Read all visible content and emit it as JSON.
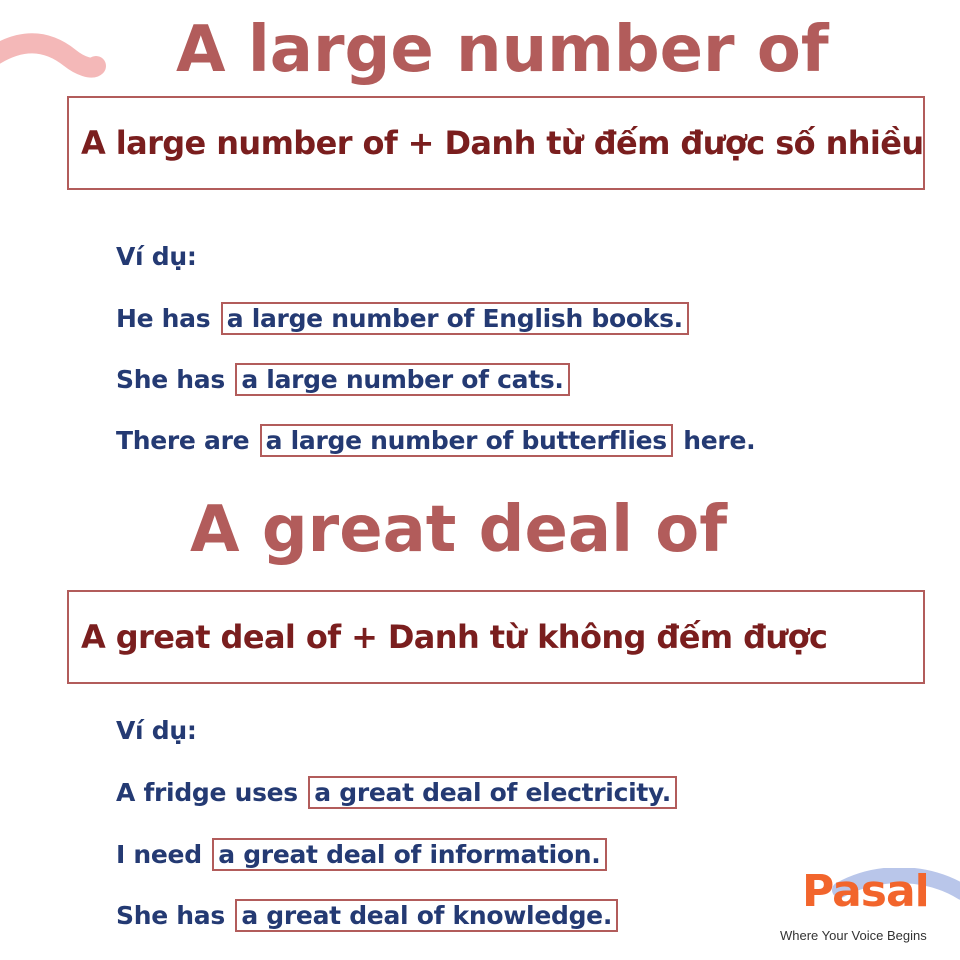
{
  "section1": {
    "title": "A large number of",
    "rule": "A large number of + Danh từ đếm được số nhiều",
    "example_label": "Ví dụ:",
    "examples": [
      {
        "before": "He has",
        "highlight": "a large number of English books.",
        "after": ""
      },
      {
        "before": "She has",
        "highlight": "a large number of cats.",
        "after": ""
      },
      {
        "before": "There are",
        "highlight": "a large number of butterflies",
        "after": "here."
      }
    ]
  },
  "section2": {
    "title": "A great deal of",
    "rule": "A great deal of + Danh từ không đếm được",
    "example_label": "Ví dụ:",
    "examples": [
      {
        "before": "A fridge uses",
        "highlight": "a great deal of electricity.",
        "after": ""
      },
      {
        "before": "I need",
        "highlight": "a great deal of information.",
        "after": ""
      },
      {
        "before": "She has",
        "highlight": "a great deal of knowledge.",
        "after": ""
      }
    ]
  },
  "logo": {
    "name": "Pasal",
    "tagline": "Where Your Voice Begins"
  },
  "colors": {
    "title": "#b25c5b",
    "rule_text": "#7a1e1e",
    "example_text": "#243a73",
    "logo_orange": "#f2652c",
    "decor_pink": "#f4b8b8",
    "logo_blue": "#b9c6ea"
  }
}
